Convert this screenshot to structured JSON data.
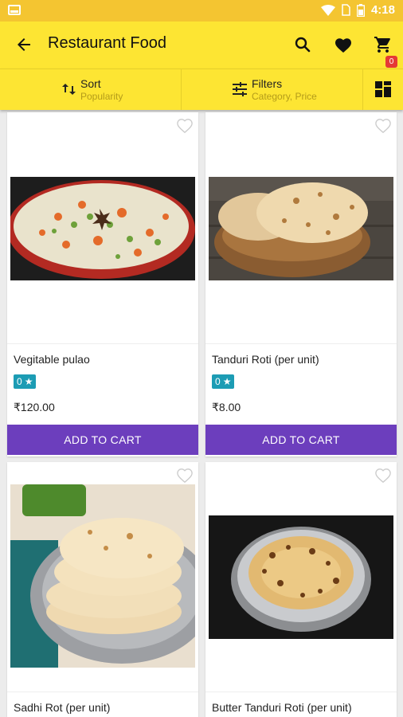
{
  "status_bar": {
    "time": "4:18"
  },
  "app_bar": {
    "title": "Restaurant Food",
    "cart_count": "0"
  },
  "filter_bar": {
    "sort_label": "Sort",
    "sort_value": "Popularity",
    "filter_label": "Filters",
    "filter_value": "Category, Price"
  },
  "products": [
    {
      "name": "Vegitable pulao",
      "rating": "0",
      "price": "₹120.00",
      "button": "ADD TO CART"
    },
    {
      "name": "Tanduri Roti (per unit)",
      "rating": "0",
      "price": "₹8.00",
      "button": "ADD TO CART"
    },
    {
      "name": "Sadhi Rot (per unit)"
    },
    {
      "name": "Butter Tanduri Roti (per unit)"
    }
  ],
  "colors": {
    "status_bar": "#f4c531",
    "app_bar": "#fde533",
    "button": "#6c3ebd",
    "rating_badge": "#1c9cb4"
  }
}
